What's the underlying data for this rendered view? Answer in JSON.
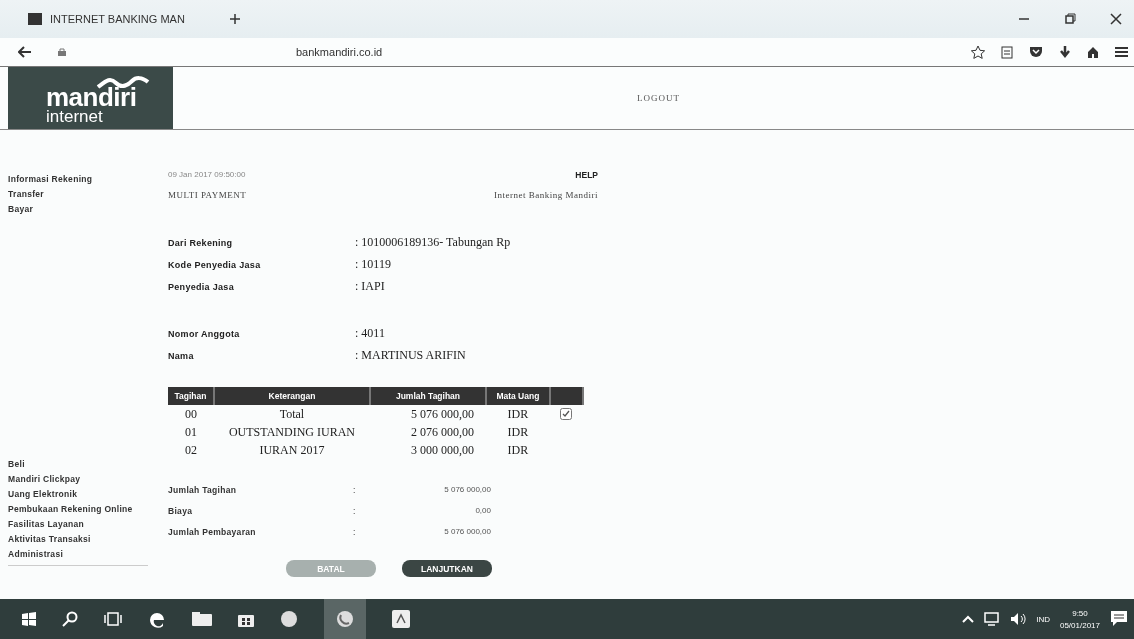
{
  "browser": {
    "tab_title": "INTERNET BANKING MAN",
    "url": "bankmandiri.co.id"
  },
  "header": {
    "logo_top": "mandiri",
    "logo_bottom": "internet",
    "logout": "LOGOUT"
  },
  "sidebar": {
    "top_items": [
      {
        "label": "Informasi Rekening"
      },
      {
        "label": "Transfer"
      },
      {
        "label": "Bayar"
      }
    ],
    "bottom_items": [
      {
        "label": "Beli"
      },
      {
        "label": "Mandiri Clickpay"
      },
      {
        "label": "Uang Elektronik"
      },
      {
        "label": "Pembukaan Rekening Online"
      },
      {
        "label": "Fasilitas Layanan"
      },
      {
        "label": "Aktivitas Transaksi"
      },
      {
        "label": "Administrasi"
      }
    ]
  },
  "content": {
    "timestamp": "09 Jan 2017 09:50:00",
    "help": "HELP",
    "title": "MULTI PAYMENT",
    "bank_name": "Internet Banking Mandiri",
    "detail_groups": [
      [
        {
          "label": "Dari Rekening",
          "value": ": 1010006189136- Tabungan  Rp"
        },
        {
          "label": "Kode Penyedia Jasa",
          "value": ": 10119"
        },
        {
          "label": "Penyedia Jasa",
          "value": ": IAPI"
        }
      ],
      [
        {
          "label": "Nomor Anggota",
          "value": ": 4011"
        },
        {
          "label": "Nama",
          "value": ": MARTINUS ARIFIN"
        }
      ]
    ],
    "table": {
      "columns": [
        "Tagihan",
        "Keterangan",
        "Jumlah Tagihan",
        "Mata Uang"
      ],
      "rows": [
        {
          "kind": "total",
          "cells": [
            "00",
            "Total",
            "5 076 000,00",
            "IDR"
          ],
          "checked": true
        },
        {
          "kind": "item",
          "cells": [
            "01",
            "OUTSTANDING IURAN",
            "2 076 000,00",
            "IDR"
          ]
        },
        {
          "kind": "item",
          "cells": [
            "02",
            "IURAN 2017",
            "3 000 000,00",
            "IDR"
          ]
        }
      ]
    },
    "summary": [
      {
        "label": "Jumlah Tagihan",
        "colon": ":",
        "value": "5 076 000,00"
      },
      {
        "label": "Biaya",
        "colon": ":",
        "value": "0,00"
      },
      {
        "label": "Jumlah Pembayaran",
        "colon": ":",
        "value": "5 076 000,00"
      }
    ],
    "buttons": [
      {
        "label": "BATAL",
        "disabled": true
      },
      {
        "label": "LANJUTKAN",
        "disabled": false
      }
    ]
  },
  "taskbar": {
    "language": "IND",
    "time": "9:50",
    "date": "05/01/2017"
  }
}
